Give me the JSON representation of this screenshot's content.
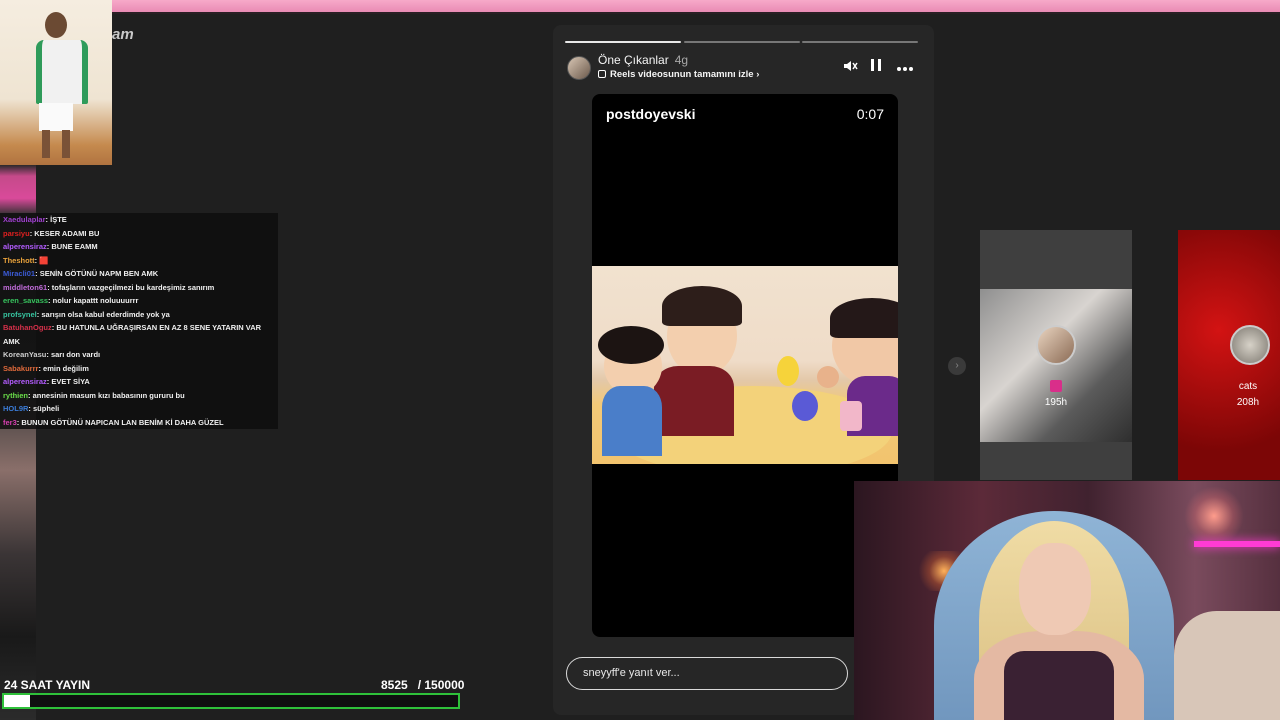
{
  "overlay": {
    "logo_fragment": "am",
    "chat": [
      {
        "user": "Xaedulaplar",
        "user_color": "#a040d0",
        "text": ": İŞTE"
      },
      {
        "user": "parsiyu",
        "user_color": "#e02020",
        "text": ": KESER ADAMI BU"
      },
      {
        "user": "alperensiraz",
        "user_color": "#b35cff",
        "text": ": BUNE EAMM"
      },
      {
        "user": "Theshott",
        "user_color": "#e9a23b",
        "text": ": 🟥"
      },
      {
        "user": "Miracli01",
        "user_color": "#3b5bd6",
        "text": ": SENİN GÖTÜNÜ NAPM BEN AMK"
      },
      {
        "user": "middleton61",
        "user_color": "#c06bd9",
        "text": ": tofaşların vazgeçilmezi bu kardeşimiz sanırım"
      },
      {
        "user": "eren_savass",
        "user_color": "#37c45e",
        "text": ": nolur kapattt noluuuurrr"
      },
      {
        "user": "profsynel",
        "user_color": "#37c4a0",
        "text": ": sarışın olsa kabul ederdimde yok ya"
      },
      {
        "user": "BatuhanOguz",
        "user_color": "#d6304a",
        "text": ": BU HATUNLA UĞRAŞIRSAN EN AZ 8 SENE YATARIN VAR AMK"
      },
      {
        "user": "KoreanYasu",
        "user_color": "#cfcfcf",
        "text": ": sarı don vardı"
      },
      {
        "user": "Sabakurrr",
        "user_color": "#e06a3b",
        "text": ": emin değilim"
      },
      {
        "user": "alperensiraz",
        "user_color": "#b35cff",
        "text": ": EVET SİYA"
      },
      {
        "user": "rythien",
        "user_color": "#6adf4a",
        "text": ": annesinin masum kızı babasının gururu bu"
      },
      {
        "user": "HOL9R",
        "user_color": "#3b7bd6",
        "text": ": süpheli"
      },
      {
        "user": "fer3",
        "user_color": "#d63fb0",
        "text": ": BUNUN GÖTÜNÜ NAPICAN LAN BENİM Kİ DAHA GÜZEL"
      }
    ],
    "stream_title": "24 SAAT YAYIN",
    "counter_current": "8525",
    "counter_total": "/ 150000",
    "progress_fraction": 0.0568
  },
  "story": {
    "segments_active": 1,
    "segments_total": 3,
    "account": "Öne Çıkanlar",
    "age": "4g",
    "subtitle": "Reels videosunun tamamını izle",
    "video_user": "postdoyevski",
    "video_time": "0:07",
    "reply_placeholder": "sneyyff'e yanıt ver...",
    "icons": [
      "mute-icon",
      "pause-icon",
      "more-icon"
    ]
  },
  "side_stories": [
    {
      "label": "195h",
      "icon": "reel-icon"
    },
    {
      "name": "cats",
      "label": "208h"
    }
  ],
  "colors": {
    "progress_border": "#2fc13a",
    "top_bar": "#f7a9c9",
    "viewer_bg": "#262626"
  }
}
